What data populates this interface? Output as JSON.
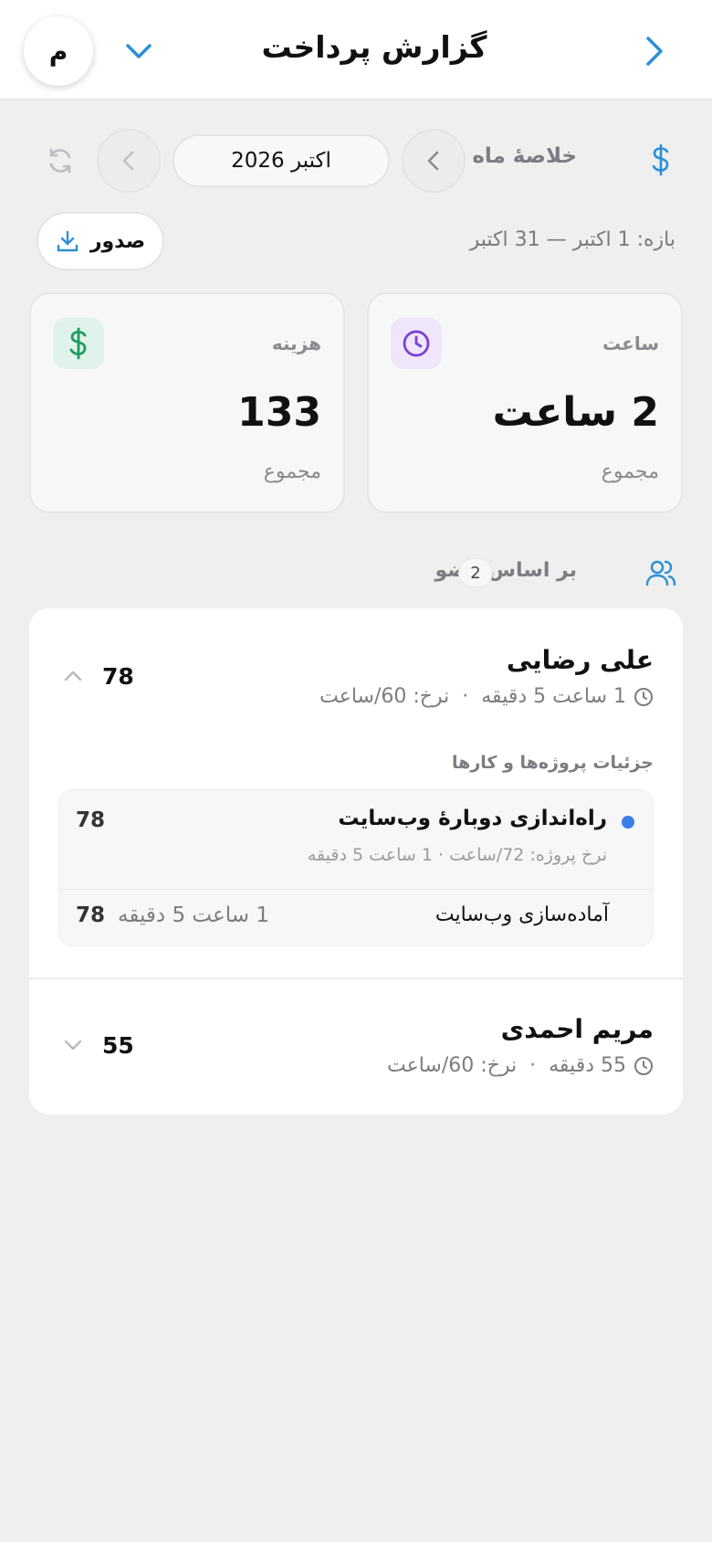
{
  "header": {
    "title": "گزارش پرداخت",
    "avatar_letter": "م"
  },
  "period": {
    "section_label": "خلاصهٔ ماه",
    "month": "اکتبر 2026",
    "range": "بازه: 1 اکتبر — 31 اکتبر",
    "export_label": "صدور"
  },
  "stats": {
    "hours": {
      "label": "ساعت",
      "value": "2 ساعت",
      "foot": "مجموع",
      "icon": "clock-icon",
      "color": "#7a3fd4"
    },
    "cost": {
      "label": "هزینه",
      "value": "133",
      "foot": "مجموع",
      "icon": "dollar-icon",
      "color": "#1f9a63"
    }
  },
  "members": {
    "label": "بر اساس عضو",
    "count": "2",
    "list": [
      {
        "name": "علی رضایی",
        "duration": "1 ساعت 5 دقیقه",
        "rate": "نرخ: 60/ساعت",
        "amount": "78",
        "expanded": true,
        "details_title": "جزئیات پروژه‌ها و کارها",
        "project": {
          "name": "راه‌اندازی دوبارهٔ وب‌سایت",
          "meta": "نرخ پروژه: 72/ساعت · 1 ساعت 5 دقیقه",
          "amount": "78",
          "task": {
            "name": "آماده‌سازی وب‌سایت",
            "duration": "1 ساعت 5 دقیقه",
            "amount": "78"
          }
        }
      },
      {
        "name": "مریم احمدی",
        "duration": "55 دقیقه",
        "rate": "نرخ: 60/ساعت",
        "amount": "55",
        "expanded": false
      }
    ]
  },
  "separator": "·",
  "colors": {
    "accent": "#2b8fd6",
    "background": "#efeff0"
  }
}
